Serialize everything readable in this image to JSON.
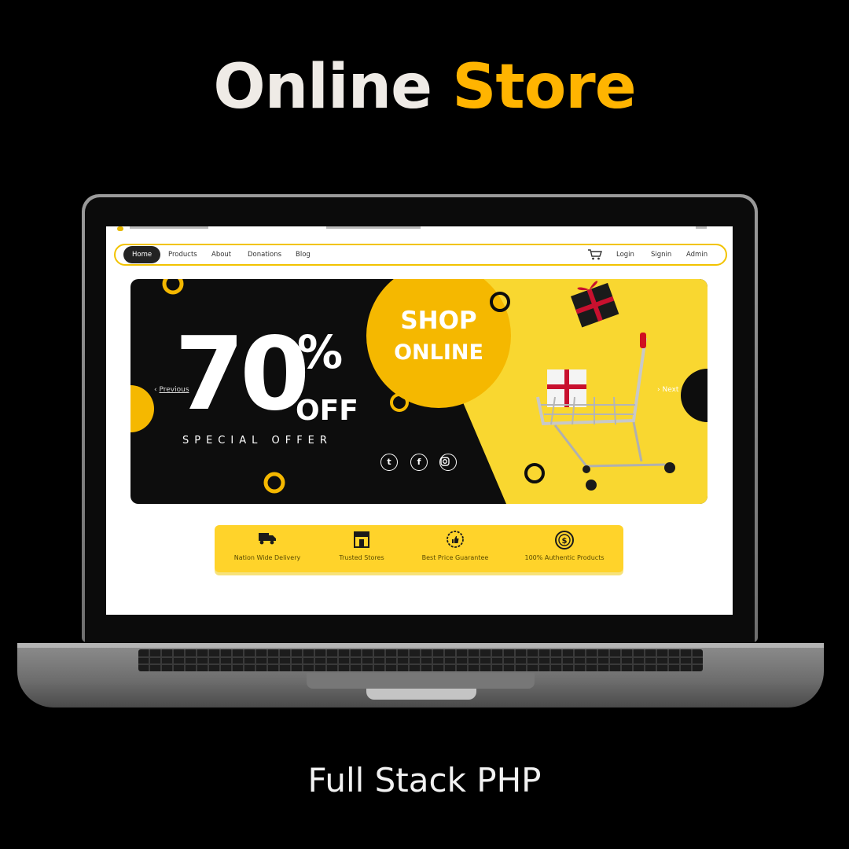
{
  "poster": {
    "title_word1": "Online",
    "title_word2": "Store",
    "subtitle": "Full Stack PHP"
  },
  "nav": {
    "items": [
      {
        "label": "Home",
        "active": true
      },
      {
        "label": "Products"
      },
      {
        "label": "About"
      },
      {
        "label": "Donations"
      },
      {
        "label": "Blog"
      }
    ],
    "cart_icon": "cart-icon",
    "right_items": [
      {
        "label": "Login"
      },
      {
        "label": "Signin"
      },
      {
        "label": "Admin"
      }
    ]
  },
  "banner": {
    "discount_number": "70",
    "discount_symbol": "%",
    "discount_word": "OFF",
    "tagline": "SPECIAL OFFER",
    "badge_line1": "SHOP",
    "badge_line2": "ONLINE",
    "prev_label": "Previous",
    "next_label": "Next",
    "social_icons": [
      "twitter-icon",
      "facebook-icon",
      "instagram-icon"
    ]
  },
  "features": [
    {
      "label": "Nation Wide Delivery",
      "icon": "truck-icon"
    },
    {
      "label": "Trusted Stores",
      "icon": "store-icon"
    },
    {
      "label": "Best Price Guarantee",
      "icon": "thumbs-up-badge-icon"
    },
    {
      "label": "100% Authentic Products",
      "icon": "dollar-coin-icon"
    }
  ],
  "colors": {
    "accent_yellow": "#ffb400",
    "banner_yellow": "#f9d730",
    "feature_yellow": "#ffd32a",
    "dark": "#0d0d0d"
  }
}
